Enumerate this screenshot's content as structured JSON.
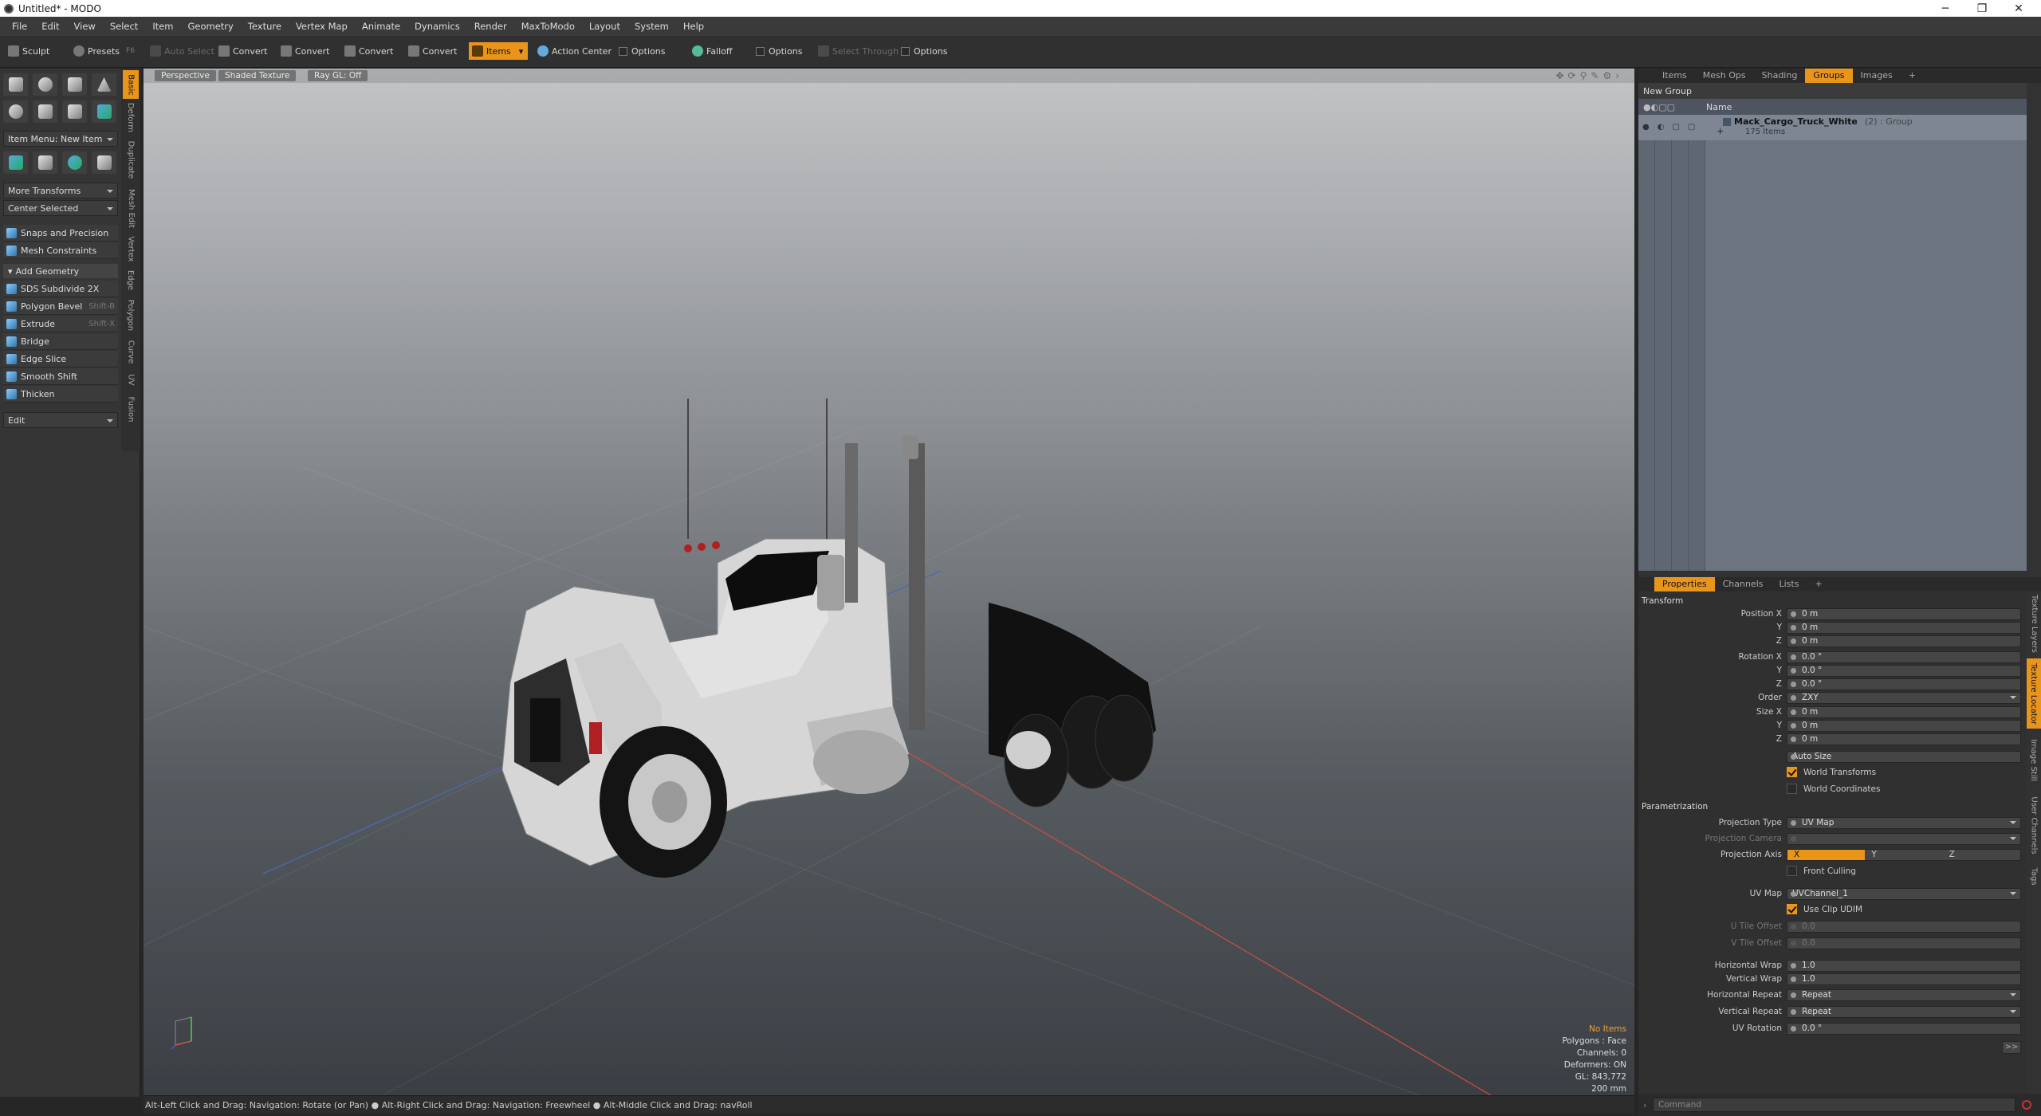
{
  "window": {
    "title": "Untitled* - MODO",
    "minimize": "─",
    "maximize": "❐",
    "close": "✕"
  },
  "menu": [
    "File",
    "Edit",
    "View",
    "Select",
    "Item",
    "Geometry",
    "Texture",
    "Vertex Map",
    "Animate",
    "Dynamics",
    "Render",
    "MaxToModo",
    "Layout",
    "System",
    "Help"
  ],
  "toolbar": {
    "sculpt": "Sculpt",
    "presets": "Presets",
    "presets_key": "F6",
    "auto_select": "Auto Select",
    "convert": "Convert",
    "items": "Items",
    "action_center": "Action Center",
    "options": "Options",
    "falloff": "Falloff",
    "select_through": "Select Through"
  },
  "left_panel": {
    "vtabs": [
      "Basic",
      "Deform",
      "Duplicate",
      "Mesh Edit",
      "Vertex",
      "Edge",
      "Polygon",
      "Curve",
      "UV",
      "Fusion"
    ],
    "item_menu": "Item Menu: New Item",
    "more_transforms": "More Transforms",
    "center_selected": "Center Selected",
    "snaps": "Snaps and Precision",
    "mesh_constraints": "Mesh Constraints",
    "add_geometry": "Add Geometry",
    "tools": [
      {
        "label": "SDS Subdivide 2X",
        "shortcut": ""
      },
      {
        "label": "Polygon Bevel",
        "shortcut": "Shift-B"
      },
      {
        "label": "Extrude",
        "shortcut": "Shift-X"
      },
      {
        "label": "Bridge",
        "shortcut": ""
      },
      {
        "label": "Edge Slice",
        "shortcut": ""
      },
      {
        "label": "Smooth Shift",
        "shortcut": ""
      },
      {
        "label": "Thicken",
        "shortcut": ""
      }
    ],
    "edit_dropdown": "Edit"
  },
  "viewport": {
    "tabs": [
      "Perspective",
      "Shaded Texture",
      "Ray GL: Off"
    ],
    "stats": {
      "items": "No Items",
      "polygons": "Polygons : Face",
      "channels": "Channels: 0",
      "deformers": "Deformers: ON",
      "gl": "GL: 843,772",
      "scale": "200 mm"
    }
  },
  "status_bar": "Alt-Left Click and Drag: Navigation: Rotate (or Pan) ● Alt-Right Click and Drag: Navigation: Freewheel ● Alt-Middle Click and Drag: navRoll",
  "right_panel": {
    "top_tabs": [
      "Items",
      "Mesh Ops",
      "Shading",
      "Groups",
      "Images",
      "+"
    ],
    "active_top_tab": "Groups",
    "new_group": "New Group",
    "name_header": "Name",
    "group_name": "Mack_Cargo_Truck_White",
    "group_suffix": "(2) : Group",
    "group_count": "175 Items",
    "prop_tabs": [
      "Properties",
      "Channels",
      "Lists",
      "+"
    ],
    "side_tabs": [
      "Texture Layers",
      "Texture Locator",
      "Image Still",
      "User Channels",
      "Tags"
    ],
    "properties": {
      "transform_label": "Transform",
      "position_x": "0 m",
      "position_y": "0 m",
      "position_z": "0 m",
      "rotation_x": "0.0 °",
      "rotation_y": "0.0 °",
      "rotation_z": "0.0 °",
      "order": "ZXY",
      "size_x": "0 m",
      "size_y": "0 m",
      "size_z": "0 m",
      "auto_size": "Auto Size",
      "world_transforms": "World Transforms",
      "world_coordinates": "World Coordinates",
      "parametrization_label": "Parametrization",
      "projection_type": "UV Map",
      "projection_camera": "",
      "axis_x": "X",
      "axis_y": "Y",
      "axis_z": "Z",
      "front_culling": "Front Culling",
      "uv_map": "UVChannel_1",
      "use_clip_udim": "Use Clip UDIM",
      "u_tile_offset": "0.0",
      "v_tile_offset": "0.0",
      "horizontal_wrap": "1.0",
      "vertical_wrap": "1.0",
      "horizontal_repeat": "Repeat",
      "vertical_repeat": "Repeat",
      "uv_rotation": "0.0 °"
    },
    "labels": {
      "position_x": "Position X",
      "y": "Y",
      "z": "Z",
      "rotation_x": "Rotation X",
      "order": "Order",
      "size_x": "Size X",
      "projection_type": "Projection Type",
      "projection_camera": "Projection Camera",
      "projection_axis": "Projection Axis",
      "uv_map": "UV Map",
      "u_tile_offset": "U Tile Offset",
      "v_tile_offset": "V Tile Offset",
      "horizontal_wrap": "Horizontal Wrap",
      "vertical_wrap": "Vertical Wrap",
      "horizontal_repeat": "Horizontal Repeat",
      "vertical_repeat": "Vertical Repeat",
      "uv_rotation": "UV Rotation"
    },
    "command_placeholder": "Command",
    "more": ">>"
  },
  "colors": {
    "accent": "#e8951a"
  }
}
